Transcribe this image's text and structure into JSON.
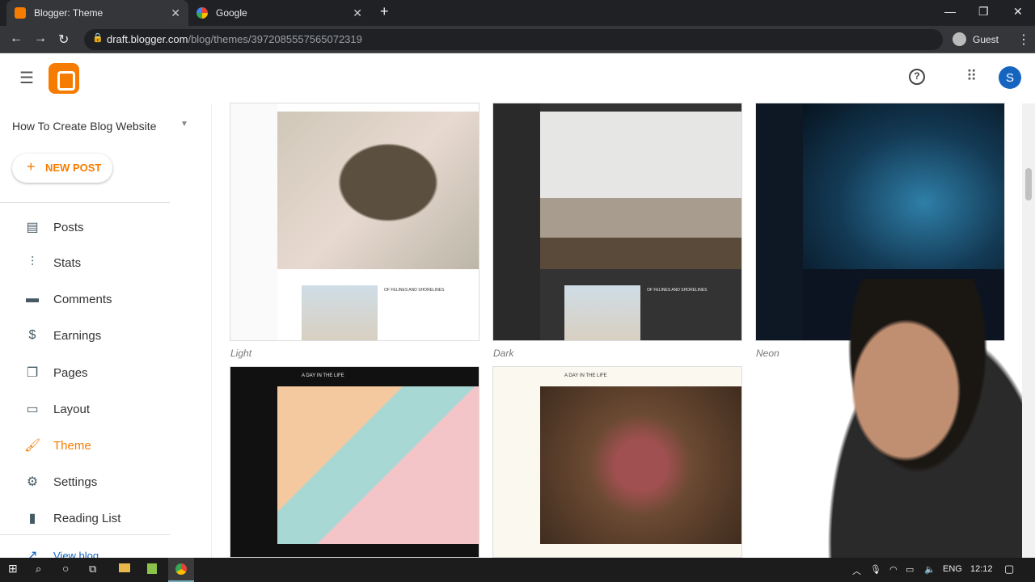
{
  "browser": {
    "tabs": [
      {
        "label": "Blogger: Theme",
        "active": true
      },
      {
        "label": "Google",
        "active": false
      }
    ],
    "url_host": "draft.blogger.com",
    "url_path": "/blog/themes/3972085557565072319",
    "profile": "Guest"
  },
  "header": {
    "avatar_letter": "S"
  },
  "sidebar": {
    "blog_name": "How To Create Blog Website",
    "new_post": "NEW POST",
    "items": [
      {
        "label": "Posts",
        "icon": "▤"
      },
      {
        "label": "Stats",
        "icon": "⫶"
      },
      {
        "label": "Comments",
        "icon": "▬"
      },
      {
        "label": "Earnings",
        "icon": "$"
      },
      {
        "label": "Pages",
        "icon": "❐"
      },
      {
        "label": "Layout",
        "icon": "▭"
      },
      {
        "label": "Theme",
        "icon": "🖌"
      },
      {
        "label": "Settings",
        "icon": "⚙"
      },
      {
        "label": "Reading List",
        "icon": "▮"
      }
    ],
    "view_blog": "View blog"
  },
  "themes": [
    {
      "name": "Light"
    },
    {
      "name": "Dark"
    },
    {
      "name": "Neon"
    },
    {
      "name": ""
    },
    {
      "name": ""
    }
  ],
  "theme_thumbs": {
    "headline": "OF FELINES AND SHORELINES",
    "banner": "A DAY IN THE LIFE"
  },
  "taskbar": {
    "lang": "ENG",
    "time": "12:12"
  }
}
